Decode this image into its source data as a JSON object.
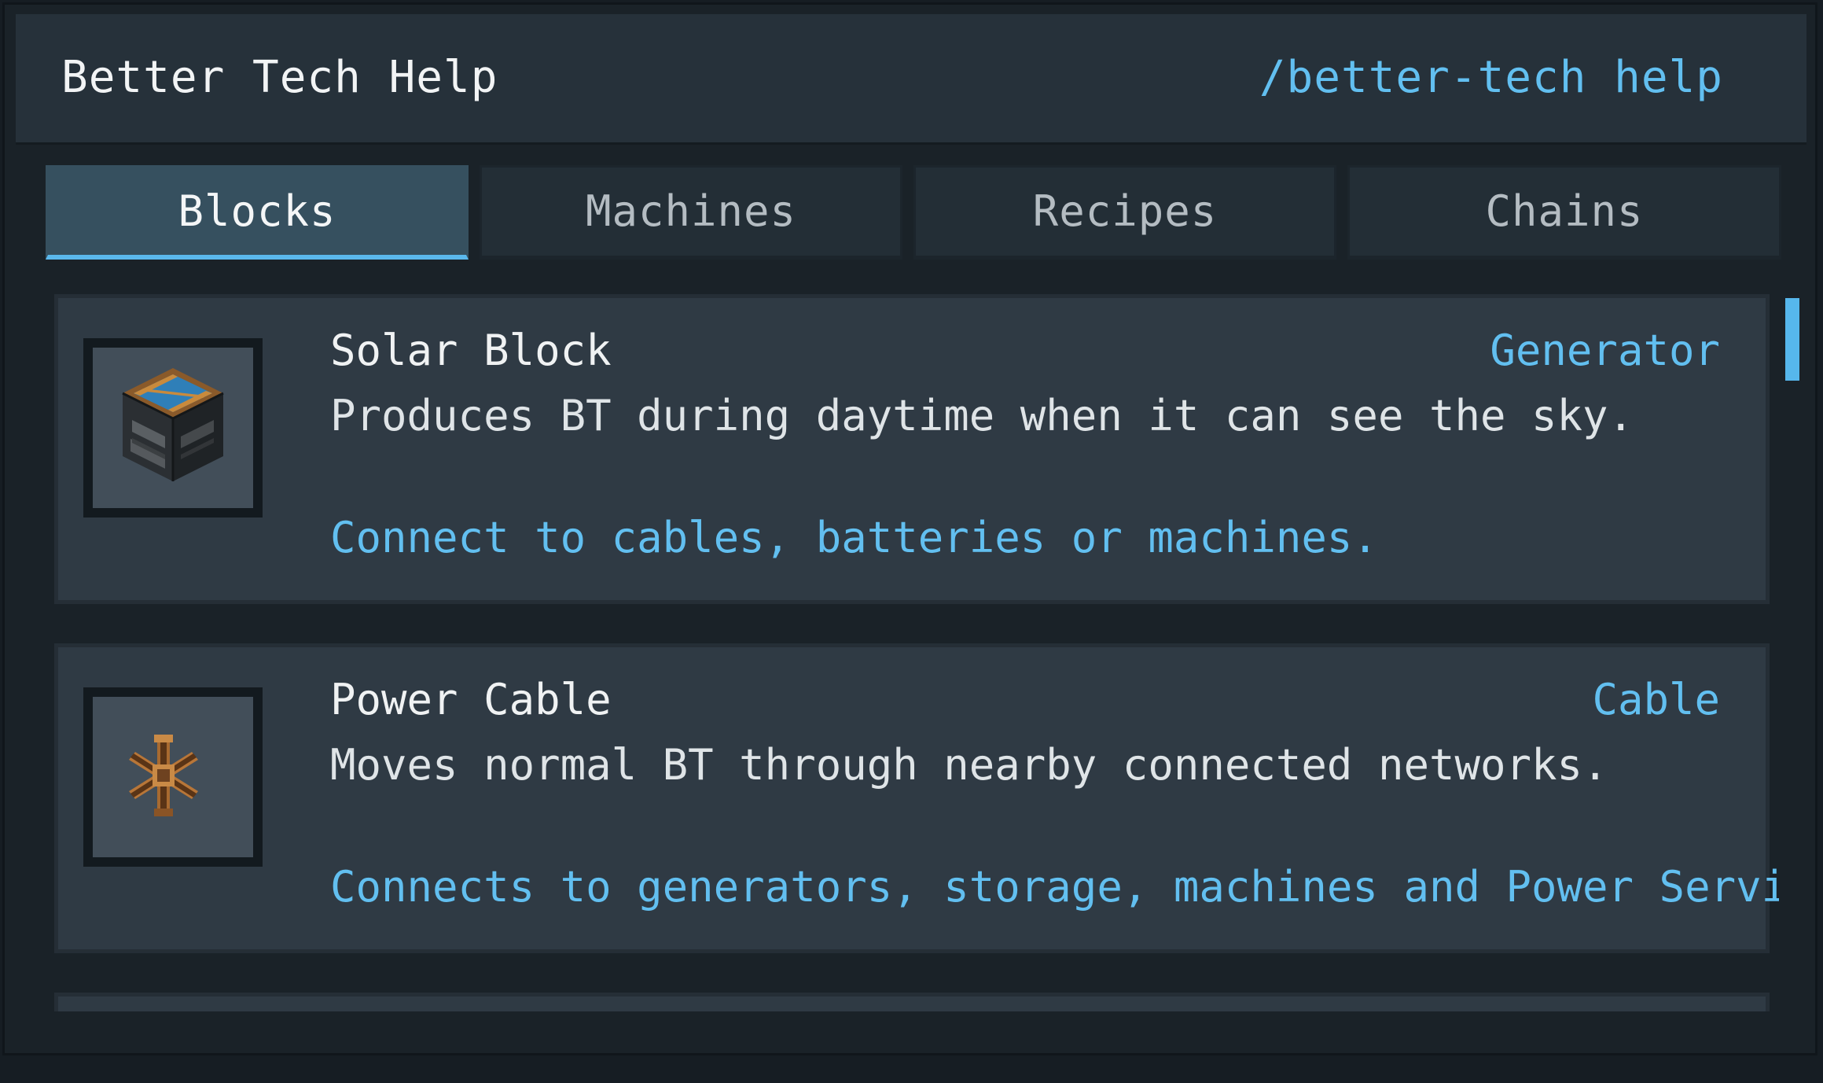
{
  "header": {
    "title": "Better Tech Help",
    "command": "/better-tech help"
  },
  "tabs": [
    {
      "label": "Blocks",
      "active": true
    },
    {
      "label": "Machines",
      "active": false
    },
    {
      "label": "Recipes",
      "active": false
    },
    {
      "label": "Chains",
      "active": false
    }
  ],
  "blocks": [
    {
      "name": "Solar Block",
      "type": "Generator",
      "description": "Produces BT during daytime when it can see the sky.",
      "note": "Connect to cables, batteries or machines.",
      "icon": "solar-block-icon"
    },
    {
      "name": "Power Cable",
      "type": "Cable",
      "description": "Moves normal BT through nearby connected networks.",
      "note": "Connects to generators, storage, machines and Power Service",
      "icon": "power-cable-icon"
    }
  ],
  "colors": {
    "accent": "#62bff0",
    "active_tab": "#36505f",
    "card_bg": "#2f3a44",
    "window_bg": "#1a2228"
  }
}
